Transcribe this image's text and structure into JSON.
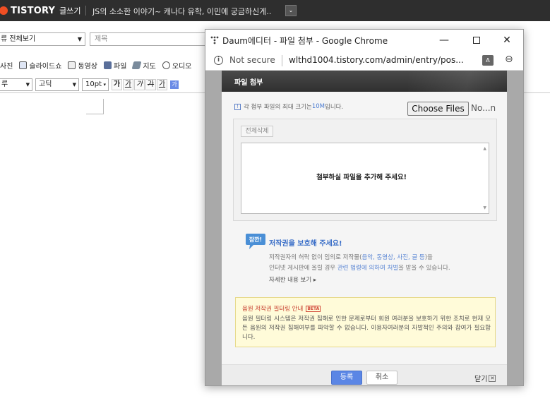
{
  "topbar": {
    "logo_text": "TISTORY",
    "logo_sub": "글쓰기",
    "blog_title": "JS의 소소한 이야기~ 캐나다 유학, 이민에 궁금하신게..",
    "dropdown_glyph": "⌄"
  },
  "editor": {
    "category_value": "류 전체보기",
    "title_placeholder": "제목",
    "toolbar_items": [
      "사진",
      "슬라이드쇼",
      "동영상",
      "파일",
      "지도",
      "오디오"
    ],
    "font_size_value": "루",
    "font_family_value": "고딕",
    "font_px_value": "10pt",
    "format_buttons": [
      "가",
      "가",
      "가",
      "가",
      "가"
    ]
  },
  "popup": {
    "window_title": "Daum에디터 - 파일 첨부 - Google Chrome",
    "not_secure": "Not secure",
    "url": "wlthd1004.tistory.com/admin/entry/pos...",
    "panel_title": "파일 첨부",
    "size_note_prefix": "각 첨부 파일의 최대 크기는 ",
    "size_note_value": "10M",
    "size_note_suffix": " 입니다.",
    "choose_files_label": "Choose Files",
    "no_file_text": "No...n",
    "delete_all_label": "전체삭제",
    "empty_message": "첨부하실 파일을 추가해 주세요!",
    "copyright": {
      "badge": "잠깐!",
      "title": "저작권을 보호해 주세요!",
      "line1_a": "저작권자의 허락 없이 임의로 저작물(",
      "line1_link": "음악, 동영상, 사진, 글 등",
      "line1_b": ")을",
      "line2_a": "인터넷 게시판에 올릴 경우 ",
      "line2_link1": "관련 법령에 의하여 처벌",
      "line2_b": "을 받을 수 있습니다.",
      "more": "자세한 내용 보기 ▸"
    },
    "filter": {
      "title": "음원 저작권 필터링 안내",
      "beta": "BETA",
      "text": "음원 필터링 시스템은 저작권 침해로 인한 문제로부터 회원 여러분을 보호하기 위한 조치로 현재 모든 음원의 저작권 침해여부를 파악할 수 없습니다. 이용자여러분의 자발적인 주의와 참여가 필요합니다."
    },
    "ok_label": "등록",
    "cancel_label": "취소",
    "close_label": "닫기"
  },
  "colors": {
    "brand": "#f04e23",
    "accent": "#5b86e5",
    "header_dark": "#2e2e2e"
  }
}
